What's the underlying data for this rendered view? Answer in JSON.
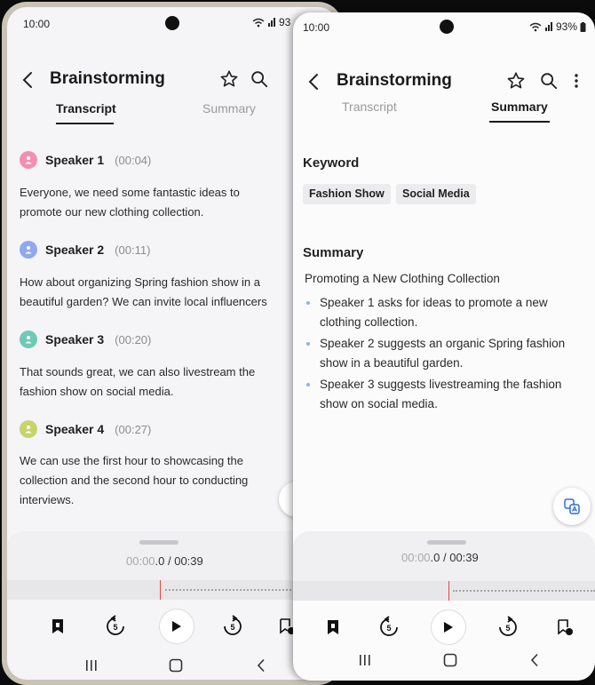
{
  "left_screen": {
    "status": {
      "time": "10:00",
      "battery": "93"
    },
    "app_bar": {
      "title": "Brainstorming"
    },
    "tabs": [
      {
        "label": "Transcript"
      },
      {
        "label": "Summary"
      }
    ],
    "transcript": [
      {
        "speaker": "Speaker 1",
        "time": "(00:04)",
        "color": "#f48fb1",
        "lines": [
          "Everyone, we need some fantastic ideas to",
          "promote our new clothing collection."
        ]
      },
      {
        "speaker": "Speaker 2",
        "time": "(00:11)",
        "color": "#90a9ee",
        "lines": [
          "How about organizing Spring fashion show in a",
          "beautiful garden? We can invite local influencers"
        ]
      },
      {
        "speaker": "Speaker 3",
        "time": "(00:20)",
        "color": "#6fcab5",
        "lines": [
          "That sounds great, we can also livestream the",
          "fashion show on social media."
        ]
      },
      {
        "speaker": "Speaker 4",
        "time": "(00:27)",
        "color": "#c7d46a",
        "lines": [
          "We can use the first hour to showcasing the",
          "collection and the second hour to conducting",
          "interviews."
        ]
      }
    ],
    "player": {
      "elapsed_dim": "00:00",
      "elapsed_main": ".0",
      "total": " / 00:39"
    }
  },
  "right_screen": {
    "status": {
      "time": "10:00",
      "battery": "93%"
    },
    "app_bar": {
      "title": "Brainstorming"
    },
    "tabs": [
      {
        "label": "Transcript"
      },
      {
        "label": "Summary"
      }
    ],
    "keyword_title": "Keyword",
    "keywords": [
      "Fashion Show",
      "Social Media"
    ],
    "summary_title": "Summary",
    "summary_heading": "Promoting a New Clothing Collection",
    "summary_points": [
      [
        "Speaker 1 asks for ideas to promote a new",
        "clothing collection."
      ],
      [
        "Speaker 2 suggests an organic Spring fashion",
        "show in a beautiful garden."
      ],
      [
        "Speaker 3 suggests livestreaming the fashion",
        "show on social media."
      ]
    ],
    "player": {
      "elapsed_dim": "00:00",
      "elapsed_main": ".0",
      "total": " / 00:39"
    }
  },
  "control_icons": [
    "bookmark-icon",
    "rewind-5-icon",
    "play-icon",
    "forward-5-icon",
    "add-bookmark-icon"
  ],
  "colors": {
    "accent_playhead": "#e2493c",
    "bullet": "#8fb3e6",
    "fab_icon": "#2f6fd8"
  }
}
